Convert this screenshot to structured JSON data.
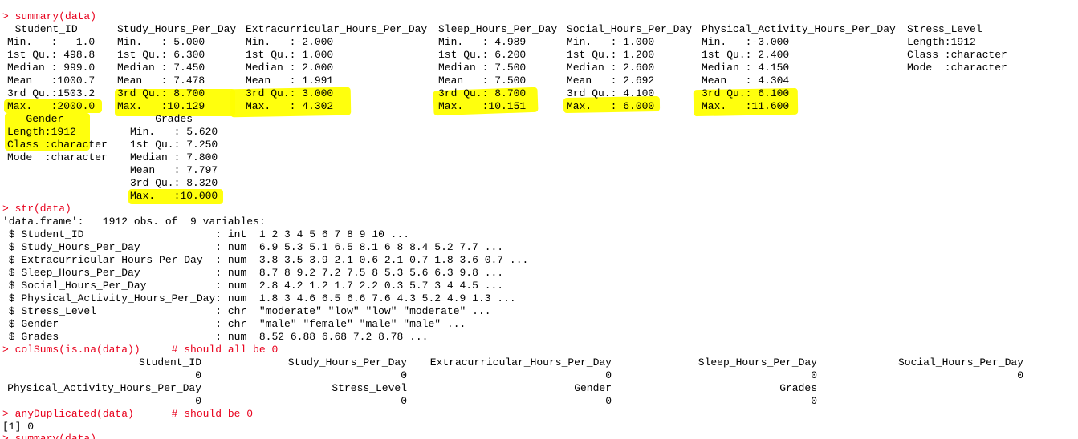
{
  "colors": {
    "prompt_and_command": "#e8001c",
    "output_text": "#000000",
    "highlighter": "#ffff00",
    "background": "#ffffff"
  },
  "commands": {
    "summary": "> summary(data)",
    "str": "> str(data)",
    "colsums": "> colSums(is.na(data))     # should all be 0",
    "anydup": "> anyDuplicated(data)      # should be 0",
    "next": "> summary(data)"
  },
  "summary": {
    "headers": [
      "  Student_ID",
      "Study_Hours_Per_Day",
      "Extracurricular_Hours_Per_Day",
      "Sleep_Hours_Per_Day",
      "Social_Hours_Per_Day",
      "Physical_Activity_Hours_Per_Day",
      "Stress_Level"
    ],
    "rows": [
      [
        "Min.   :   1.0",
        "Min.   : 5.000",
        "Min.   :-2.000",
        "Min.   : 4.989",
        "Min.   :-1.000",
        "Min.   :-3.000",
        "Length:1912"
      ],
      [
        "1st Qu.: 498.8",
        "1st Qu.: 6.300",
        "1st Qu.: 1.000",
        "1st Qu.: 6.200",
        "1st Qu.: 1.200",
        "1st Qu.: 2.400",
        "Class :character"
      ],
      [
        "Median : 999.0",
        "Median : 7.450",
        "Median : 2.000",
        "Median : 7.500",
        "Median : 2.600",
        "Median : 4.150",
        "Mode  :character"
      ],
      [
        "Mean   :1000.7",
        "Mean   : 7.478",
        "Mean   : 1.991",
        "Mean   : 7.500",
        "Mean   : 2.692",
        "Mean   : 4.304",
        ""
      ],
      [
        "3rd Qu.:1503.2",
        "3rd Qu.: 8.700",
        "3rd Qu.: 3.000",
        "3rd Qu.: 8.700",
        "3rd Qu.: 4.100",
        "3rd Qu.: 6.100",
        ""
      ],
      [
        "Max.   :2000.0",
        "Max.   :10.129",
        "Max.   : 4.302",
        "Max.   :10.151",
        "Max.   : 6.000",
        "Max.   :11.600",
        ""
      ]
    ],
    "block2_headers": [
      "   Gender",
      "    Grades"
    ],
    "block2_rows": [
      [
        "Length:1912",
        "Min.   : 5.620"
      ],
      [
        "Class :character",
        "1st Qu.: 7.250"
      ],
      [
        "Mode  :character",
        "Median : 7.800"
      ],
      [
        "",
        "Mean   : 7.797"
      ],
      [
        "",
        "3rd Qu.: 8.320"
      ],
      [
        "",
        "Max.   :10.000"
      ]
    ]
  },
  "str_output": [
    "'data.frame':   1912 obs. of  9 variables:",
    " $ Student_ID                     : int  1 2 3 4 5 6 7 8 9 10 ...",
    " $ Study_Hours_Per_Day            : num  6.9 5.3 5.1 6.5 8.1 6 8 8.4 5.2 7.7 ...",
    " $ Extracurricular_Hours_Per_Day  : num  3.8 3.5 3.9 2.1 0.6 2.1 0.7 1.8 3.6 0.7 ...",
    " $ Sleep_Hours_Per_Day            : num  8.7 8 9.2 7.2 7.5 8 5.3 5.6 6.3 9.8 ...",
    " $ Social_Hours_Per_Day           : num  2.8 4.2 1.2 1.7 2.2 0.3 5.7 3 4 4.5 ...",
    " $ Physical_Activity_Hours_Per_Day: num  1.8 3 4.6 6.5 6.6 7.6 4.3 5.2 4.9 1.3 ...",
    " $ Stress_Level                   : chr  \"moderate\" \"low\" \"low\" \"moderate\" ...",
    " $ Gender                         : chr  \"male\" \"female\" \"male\" \"male\" ...",
    " $ Grades                         : num  8.52 6.88 6.68 7.2 8.78 ..."
  ],
  "colsums_output": {
    "names_row1": [
      "Student_ID",
      "Study_Hours_Per_Day",
      "Extracurricular_Hours_Per_Day",
      "Sleep_Hours_Per_Day",
      "Social_Hours_Per_Day"
    ],
    "values_row1": [
      "0",
      "0",
      "0",
      "0",
      "0"
    ],
    "names_row2": [
      "Physical_Activity_Hours_Per_Day",
      "Stress_Level",
      "Gender",
      "Grades"
    ],
    "values_row2": [
      "0",
      "0",
      "0",
      "0"
    ]
  },
  "anydup_output": "[1] 0"
}
